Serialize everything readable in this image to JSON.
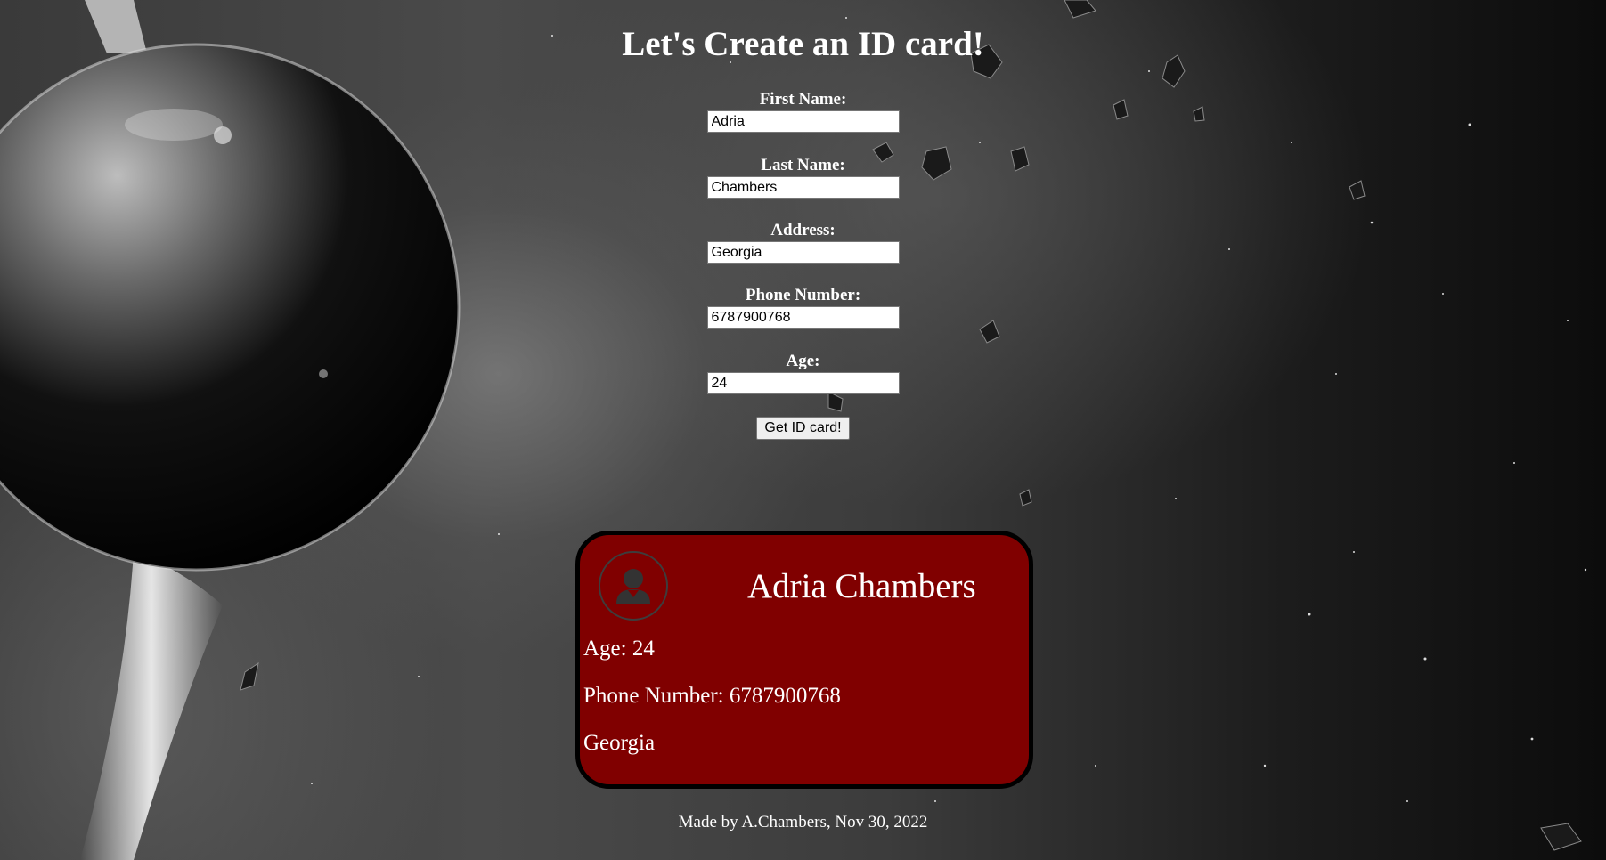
{
  "page": {
    "title": "Let's Create an ID card!"
  },
  "form": {
    "first_name": {
      "label": "First Name:",
      "value": "Adria"
    },
    "last_name": {
      "label": "Last Name:",
      "value": "Chambers"
    },
    "address": {
      "label": "Address:",
      "value": "Georgia"
    },
    "phone": {
      "label": "Phone Number:",
      "value": "6787900768"
    },
    "age": {
      "label": "Age:",
      "value": "24"
    },
    "submit_label": "Get ID card!"
  },
  "card": {
    "name": "Adria Chambers",
    "age_line": "Age: 24",
    "phone_line": "Phone Number: 6787900768",
    "address_line": "Georgia",
    "avatar_icon": "user-avatar-icon",
    "background_color": "#800000"
  },
  "footer": {
    "text": "Made by A.Chambers, Nov 30, 2022"
  }
}
